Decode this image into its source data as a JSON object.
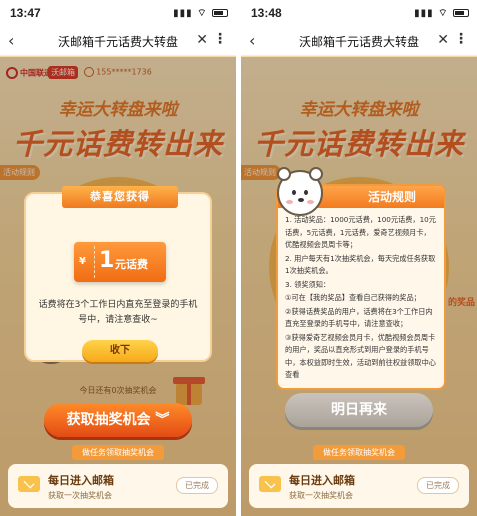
{
  "left": {
    "status": {
      "time": "13:47",
      "network": "▮▮▮ ⌔"
    },
    "nav": {
      "back": "‹",
      "title": "沃邮箱千元话费大转盘",
      "close": "✕",
      "more": "⋮"
    },
    "header": {
      "brand_cu": "中国联通",
      "brand_wo": "沃邮箱",
      "phone_masked": "155*****1736"
    },
    "headline": {
      "line1": "幸运大转盘来啦",
      "line2": "千元话费转出来"
    },
    "rules_tag": "活动规则",
    "prize_popup": {
      "title": "恭喜您获得",
      "coupon_currency": "¥",
      "coupon_amount": "1",
      "coupon_unit": "元话费",
      "message": "话费将在3个工作日内直充至登录的手机号中，请注意查收~",
      "confirm_label": "收下"
    },
    "chances": "今日还有0次抽奖机会",
    "main_button": "获取抽奖机会 ︾",
    "task_section": "做任务领取抽奖机会",
    "task": {
      "title": "每日进入邮箱",
      "subtitle": "获取一次抽奖机会",
      "state": "已完成"
    }
  },
  "right": {
    "status": {
      "time": "13:48",
      "network": "▮▮▮ ⌔"
    },
    "nav": {
      "back": "‹",
      "title": "沃邮箱千元话费大转盘",
      "close": "✕",
      "more": "⋮"
    },
    "headline": {
      "line1": "幸运大转盘来啦",
      "line2": "千元话费转出来"
    },
    "rules_tag": "活动规则",
    "rules_popup": {
      "title": "活动规则",
      "items": [
        "1. 活动奖品：1000元话费，100元话费，10元话费，5元话费，1元话费，爱奇艺视频月卡，优酷视频会员周卡等；",
        "2. 用户每天有1次抽奖机会，每天完成任务获取1次抽奖机会。",
        "3. 领奖须知：",
        "①可在【我的奖品】查看自己获得的奖品；",
        "②获得话费奖品的用户，话费将在3个工作日内直充至登录的手机号中，请注意查收；",
        "③获得爱奇艺视频会员月卡，优酷视频会员周卡的用户，奖品以直充形式到用户登录的手机号中，本权益即时生效，活动到前往权益领取中心查看"
      ]
    },
    "prize_corner": "的奖品",
    "main_button": "明日再来",
    "task_section": "做任务领取抽奖机会",
    "task": {
      "title": "每日进入邮箱",
      "subtitle": "获取一次抽奖机会",
      "state": "已完成"
    }
  },
  "colors": {
    "accent_orange": "#f27b1f",
    "headline_orange": "#e4541b",
    "brand_red": "#c8161d"
  }
}
